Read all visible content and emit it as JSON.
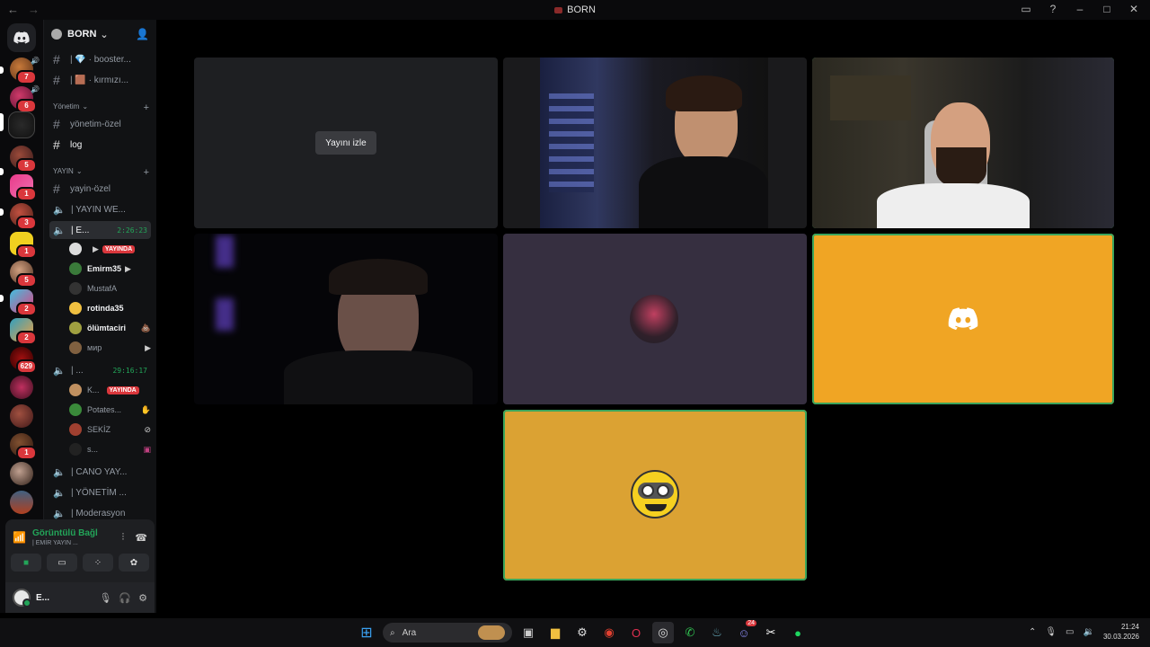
{
  "window": {
    "title": "BORN"
  },
  "server": {
    "name": "BORN"
  },
  "rail_badges": [
    "7",
    "6",
    "5",
    "1",
    "3",
    "1",
    "5",
    "2",
    "2",
    "629",
    "1"
  ],
  "channels": {
    "booster": "| 💎 · booster...",
    "kirmizi": "| 🟫 · kırmızı...",
    "cat_yonetim": "Yönetim",
    "yonetim_ozel": "yönetim-özel",
    "log": "log",
    "cat_yayin": "YAYIN",
    "yayin_ozel": "yayin-özel",
    "yayin_we": "| YAYIN WE...",
    "current": "| E...",
    "current_timer": "2:26:23",
    "second_voice": "| ...",
    "second_timer": "29:16:17",
    "cano": "| CANO YAY...",
    "yonetim_voice": "| YÖNETİM ...",
    "moderasyon": "| Moderasyon"
  },
  "live_label": "YAYINDA",
  "voice_users_1": [
    {
      "name": "",
      "live": true
    },
    {
      "name": "Emirm35"
    },
    {
      "name": "MustafA"
    },
    {
      "name": "rotinda35"
    },
    {
      "name": "ölümtaciri"
    },
    {
      "name": "мир"
    }
  ],
  "voice_users_2": [
    {
      "name": "K...",
      "live": true
    },
    {
      "name": "Potates..."
    },
    {
      "name": "SEKİZ"
    },
    {
      "name": "s..."
    }
  ],
  "voice_panel": {
    "status": "Görüntülü Bağl",
    "channel": "| EMİR YAYIN ...",
    "user": "E..."
  },
  "stream": {
    "watch_label": "Yayını izle"
  },
  "taskbar": {
    "search": "Ara",
    "time": "21:24",
    "date": "30.03.2026",
    "discord_badge": "24"
  },
  "colors": {
    "speaking": "#3ba55c",
    "live": "#da373c",
    "tile_orange": "#f0a524",
    "tile_orange2": "#dba233",
    "tile_purple": "#362f40"
  }
}
